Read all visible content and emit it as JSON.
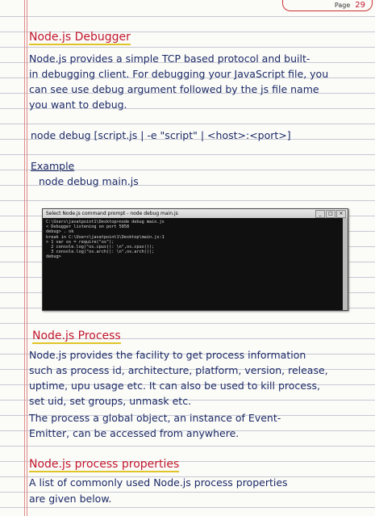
{
  "page": {
    "label": "Page",
    "number": "29"
  },
  "sections": {
    "debugger": {
      "heading": "Node.js Debugger",
      "lines": [
        "Node.js provides a simple TCP based protocol and built-",
        "in debugging client. For debugging your JavaScript file, you",
        "can see use debug argument followed by the js file name",
        "you want to debug."
      ],
      "syntax": "node debug [script.js | -e \"script\" | <host>:<port>]",
      "example_label": "Example",
      "example_cmd": "node debug main.js"
    },
    "terminal": {
      "title": "Select Node.js command prompt - node debug main.js",
      "lines": [
        "C:\\Users\\javatpoint1\\Desktop>node debug main.js",
        "< Debugger listening on port 5858",
        "debug> . ok",
        "break in C:\\Users\\javatpoint1\\Desktop\\main.js:1",
        "> 1 var os = require(\"os\");",
        "  2 console.log(\"os.cpus(): \\n\",os.cpus());",
        "  3 console.log(\"os.arch(): \\n\",os.arch());",
        "debug>"
      ]
    },
    "process": {
      "heading": "Node.js Process",
      "lines": [
        "Node.js provides the facility to get process information",
        "such as process id, architecture, platform, version, release,",
        "uptime, upu usage etc. It can also be used to kill process,",
        "set uid, set groups, unmask etc.",
        "The process a global object, an instance of Event-",
        "Emitter, can be accessed from anywhere."
      ]
    },
    "properties": {
      "heading": "Node.js process properties",
      "lines": [
        "A list of commonly used Node.js process properties",
        "are given below."
      ]
    }
  }
}
